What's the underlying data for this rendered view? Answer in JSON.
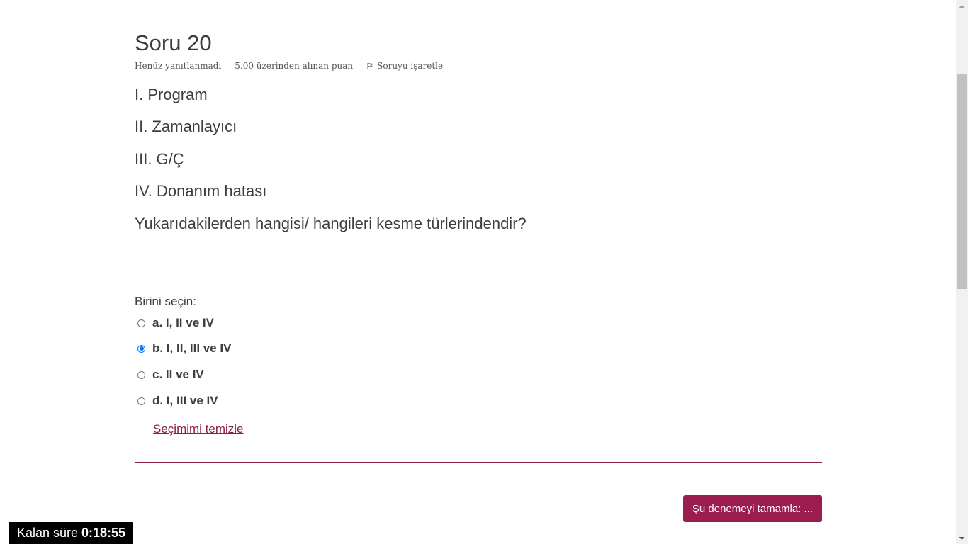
{
  "question": {
    "title": "Soru 20",
    "state": "Henüz yanıtlanmadı",
    "grade": "5.00 üzerinden alınan puan",
    "flag_label": "Soruyu işaretle",
    "lines": [
      "I. Program",
      "II. Zamanlayıcı",
      "III. G/Ç",
      "IV. Donanım hatası",
      "Yukarıdakilerden hangisi/ hangileri kesme türlerindendir?"
    ],
    "prompt": "Birini seçin:",
    "options": [
      {
        "label": "a. I, II ve IV",
        "selected": false
      },
      {
        "label": "b. I, II, III ve IV",
        "selected": true
      },
      {
        "label": "c. II ve IV",
        "selected": false
      },
      {
        "label": "d. I, III ve IV",
        "selected": false
      }
    ],
    "clear_label": "Seçimimi temizle"
  },
  "finish_button_label": "Şu denemeyi tamamla: ...",
  "timer": {
    "label": "Kalan süre",
    "time": "0:18:55"
  },
  "colors": {
    "accent": "#9b1c4f",
    "link": "#8c1d4a",
    "radio_selected": "#0075ff"
  }
}
